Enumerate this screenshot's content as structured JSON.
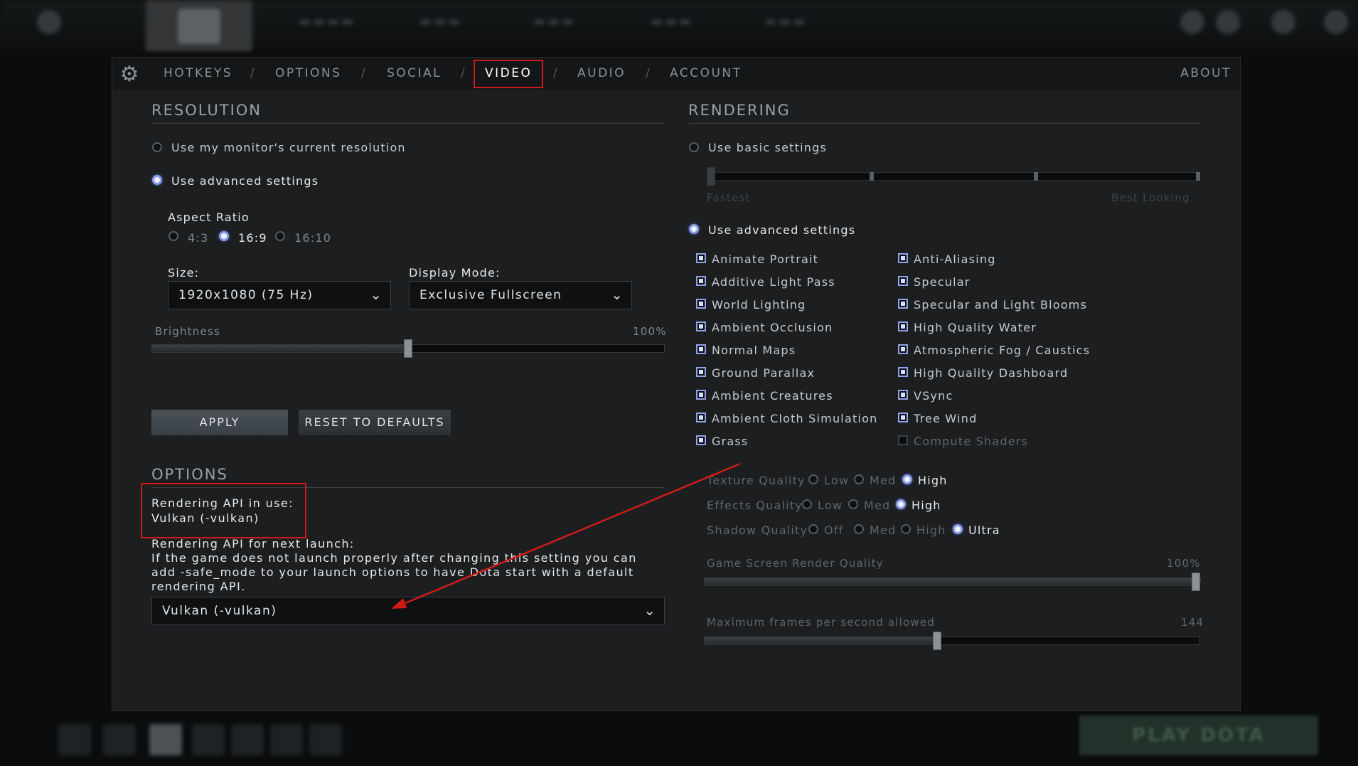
{
  "tabs": {
    "hotkeys": "HOTKEYS",
    "options": "OPTIONS",
    "social": "SOCIAL",
    "video": "VIDEO",
    "audio": "AUDIO",
    "account": "ACCOUNT",
    "about": "ABOUT",
    "separator": "/"
  },
  "resolution": {
    "title": "RESOLUTION",
    "use_current": "Use my monitor's current resolution",
    "use_advanced": "Use advanced settings",
    "aspect_ratio_label": "Aspect Ratio",
    "aspect_options": [
      "4:3",
      "16:9",
      "16:10"
    ],
    "aspect_selected": "16:9",
    "size_label": "Size:",
    "size_value": "1920x1080 (75 Hz)",
    "display_mode_label": "Display Mode:",
    "display_mode_value": "Exclusive Fullscreen",
    "brightness_label": "Brightness",
    "brightness_value": "100%",
    "brightness_level": 0.5,
    "apply": "APPLY",
    "reset": "RESET TO DEFAULTS"
  },
  "options": {
    "title": "OPTIONS",
    "api_in_use_label": "Rendering API in use:",
    "api_in_use_value": "Vulkan (-vulkan)",
    "api_next_label": "Rendering API for next launch:",
    "api_next_help_1": "If the game does not launch properly after changing this setting you can",
    "api_next_help_2": "add -safe_mode to your launch options to have Dota start with a default",
    "api_next_help_3": "rendering API.",
    "api_next_value": "Vulkan (-vulkan)"
  },
  "rendering": {
    "title": "RENDERING",
    "use_basic": "Use basic settings",
    "fastest": "Fastest",
    "best_looking": "Best Looking",
    "use_advanced": "Use advanced settings",
    "checks_left": [
      "Animate Portrait",
      "Additive Light Pass",
      "World Lighting",
      "Ambient Occlusion",
      "Normal Maps",
      "Ground Parallax",
      "Ambient Creatures",
      "Ambient Cloth Simulation",
      "Grass"
    ],
    "checks_right": [
      "Anti-Aliasing",
      "Specular",
      "Specular and Light Blooms",
      "High Quality Water",
      "Atmospheric Fog / Caustics",
      "High Quality Dashboard",
      "VSync",
      "Tree Wind",
      "Compute Shaders"
    ],
    "texture_quality": "Texture Quality",
    "effects_quality": "Effects Quality",
    "shadow_quality": "Shadow Quality",
    "low": "Low",
    "med": "Med",
    "high": "High",
    "off": "Off",
    "ultra": "Ultra",
    "render_quality_label": "Game Screen Render Quality",
    "render_quality_value": "100%",
    "render_quality_level": 1.0,
    "max_fps_label": "Maximum frames per second allowed",
    "max_fps_value": "144",
    "max_fps_level": 0.47
  },
  "footer": {
    "play": "PLAY DOTA"
  },
  "colors": {
    "annotation": "#d01a1a",
    "radio_selected": "#8a9fe8"
  }
}
